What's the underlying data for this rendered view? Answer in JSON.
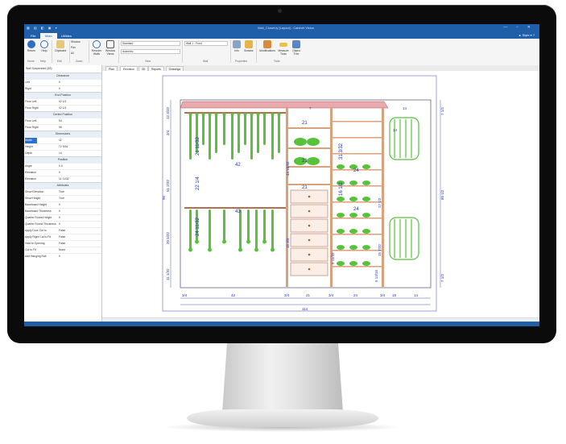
{
  "window": {
    "title": "Wall_Closet.ty [Layout] - Cabinet Vision",
    "quick_access": "▦ ▤ ◧ ▣ ▾",
    "controls": "—  ▫  ✕",
    "style_help": "▲ Style ▾ ?"
  },
  "ribbon_tabs": [
    {
      "label": "File"
    },
    {
      "label": "Main"
    },
    {
      "label": "Utilities"
    }
  ],
  "ribbon": {
    "buttons": [
      {
        "label": "Return",
        "icon": "return-icon"
      },
      {
        "label": "Help",
        "icon": "help-icon"
      },
      {
        "label": "Clipboard",
        "icon": "clipboard-icon"
      },
      {
        "label": "Reorder Walls",
        "icon": "reorder-icon"
      },
      {
        "label": "Window Views",
        "icon": "window-views-icon"
      },
      {
        "label": "Info",
        "icon": "info-icon"
      },
      {
        "label": "Browse",
        "icon": "browse-icon"
      },
      {
        "label": "Modifications",
        "icon": "modifications-icon"
      },
      {
        "label": "Measure Tools",
        "icon": "measure-icon"
      },
      {
        "label": "Object Tree",
        "icon": "object-tree-icon"
      }
    ],
    "small_buttons": [
      "Window",
      "Pan",
      "All"
    ],
    "style_select": "Standard",
    "view_select": "Isometric",
    "wall_select": "Wall 1 - Front",
    "groups": [
      "Home",
      "Help",
      "Edit",
      "Zoom",
      "View",
      "Wall",
      "Properties",
      "Tools"
    ]
  },
  "panel": {
    "header": "Wall Suspended (83)",
    "sections": [
      {
        "title": "Clearance",
        "rows": [
          [
            "Left",
            "0"
          ],
          [
            "Right",
            "0"
          ]
        ]
      },
      {
        "title": "End Position",
        "rows": [
          [
            "Floor Left",
            "42 1/2"
          ],
          [
            "Floor Right",
            "42 1/2"
          ]
        ]
      },
      {
        "title": "Centre Position",
        "rows": [
          [
            "Floor Left",
            "54"
          ],
          [
            "Floor Right",
            "96"
          ]
        ]
      },
      {
        "title": "Dimensions",
        "rows": [
          [
            "Width",
            "42"
          ],
          [
            "Height",
            "72 9/16"
          ],
          [
            "Depth",
            "14"
          ]
        ]
      },
      {
        "title": "Position",
        "rows": [
          [
            "Angle",
            "0.0"
          ],
          [
            "Elevation",
            "0"
          ],
          [
            "Elevation",
            "11 11/32"
          ]
        ]
      },
      {
        "title": "Attributes",
        "rows": [
          [
            "Show Elevation",
            "True"
          ],
          [
            "Show Height",
            "True"
          ],
          [
            "Baseboard Height",
            "0"
          ],
          [
            "Baseboard Thickness",
            "0"
          ],
          [
            "Quarter Round Height",
            "0"
          ],
          [
            "Quarter Round Thickness",
            "0"
          ],
          [
            "Apply Door Cut to",
            "False"
          ],
          [
            "Apply Right Cut to Fit",
            "False"
          ],
          [
            "Hold to Opening",
            "False"
          ],
          [
            "Cut to Fit",
            "None"
          ],
          [
            "Add Hanging Rail",
            "0"
          ]
        ]
      }
    ],
    "selected_row": "Width"
  },
  "doc_tabs": [
    {
      "label": "Plan"
    },
    {
      "label": "Elevation"
    },
    {
      "label": "3D"
    },
    {
      "label": "Reports"
    },
    {
      "label": "Drawings"
    }
  ],
  "drawing": {
    "bottom_dims": [
      "3/4",
      "42",
      "3/4",
      "21",
      "3/4",
      "24",
      "3/4",
      "18",
      "14"
    ],
    "total_width": "114",
    "left_dims": [
      "12 3/32",
      "3/4",
      "51 2/32",
      "20 5/32",
      "11 1/32"
    ],
    "overall_height": "96",
    "right_dims": [
      "7 1/2",
      "80 1/2",
      "7 1/2"
    ],
    "section_labels": {
      "hang": [
        "21 11/32",
        "42",
        "22 1/4",
        "43",
        "24 11/32"
      ],
      "mid": [
        "21",
        "21",
        "21",
        "31 3/32",
        "16 1/2",
        "14"
      ],
      "shelf": [
        "24",
        "24",
        "5 13/16"
      ],
      "small": [
        "44 16/32",
        "15 3/4",
        "9 11/32",
        "17 1/2",
        "15 7/32"
      ],
      "corner": "14",
      "cube": "7"
    }
  },
  "colors": {
    "ribbon_blue": "#1f5ea8",
    "dimension_blue": "#2233aa",
    "garment_green": "#58c23a",
    "shelf_tan": "#d9a27a",
    "top_pink": "#e9a9ad"
  }
}
